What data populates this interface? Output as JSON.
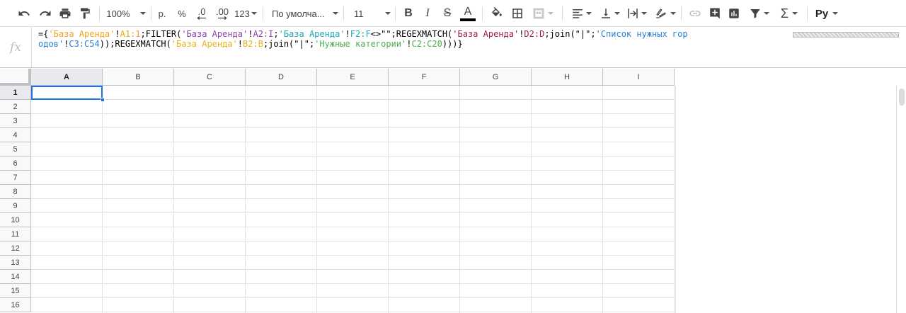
{
  "toolbar": {
    "zoom": "100%",
    "currency": "р.",
    "percent": "%",
    "dec_decrease": ".0",
    "dec_increase": ".00",
    "more_formats": "123",
    "font_family": "По умолча...",
    "font_size": "11",
    "bold": "B",
    "italic": "I",
    "strike": "S",
    "text_color_letter": "A",
    "text_color": "#000000",
    "spell_input": "Py",
    "icons": [
      "undo-icon",
      "redo-icon",
      "print-icon",
      "paint-format-icon",
      "fill-color-icon",
      "borders-icon",
      "merge-cells-icon",
      "align-left-icon",
      "valign-bottom-icon",
      "text-wrap-icon",
      "text-rotation-icon",
      "link-icon",
      "comment-icon",
      "chart-icon",
      "filter-icon",
      "sum-icon",
      "input-tools-icon"
    ]
  },
  "formula_bar": {
    "fx_label": "fx",
    "tokens": [
      {
        "text": "={",
        "color": "k"
      },
      {
        "text": "'База Аренда'",
        "color": "o"
      },
      {
        "text": "!",
        "color": "k"
      },
      {
        "text": "A1:1",
        "color": "o"
      },
      {
        "text": ";FILTER(",
        "color": "k"
      },
      {
        "text": "'База Аренда'",
        "color": "p"
      },
      {
        "text": "!",
        "color": "k"
      },
      {
        "text": "A2:I",
        "color": "p"
      },
      {
        "text": ";",
        "color": "k"
      },
      {
        "text": "'База Аренда'",
        "color": "t"
      },
      {
        "text": "!",
        "color": "k"
      },
      {
        "text": "F2:F",
        "color": "t"
      },
      {
        "text": "<>\"\";REGEXMATCH(",
        "color": "k"
      },
      {
        "text": "'База Аренда'",
        "color": "r"
      },
      {
        "text": "!",
        "color": "k"
      },
      {
        "text": "D2:D",
        "color": "r"
      },
      {
        "text": ";join(\"|\";",
        "color": "k"
      },
      {
        "text": "'Список нужных городов'",
        "color": "b"
      },
      {
        "text": "!",
        "color": "k"
      },
      {
        "text": "C3:C54",
        "color": "b"
      },
      {
        "text": "));REGEXMATCH(",
        "color": "k"
      },
      {
        "text": "'База Аренда'",
        "color": "y"
      },
      {
        "text": "!",
        "color": "k"
      },
      {
        "text": "B2:B",
        "color": "y"
      },
      {
        "text": ";join(\"|\";",
        "color": "k"
      },
      {
        "text": "'Нужные категории'",
        "color": "g"
      },
      {
        "text": "!",
        "color": "k"
      },
      {
        "text": "C2:C20",
        "color": "g"
      },
      {
        "text": ")))}",
        "color": "k"
      }
    ]
  },
  "grid": {
    "columns": [
      "A",
      "B",
      "C",
      "D",
      "E",
      "F",
      "G",
      "H",
      "I"
    ],
    "rows": [
      "1",
      "2",
      "3",
      "4",
      "5",
      "6",
      "7",
      "8",
      "9",
      "10",
      "11",
      "12",
      "13",
      "14",
      "15",
      "16"
    ],
    "active_cell": "A1",
    "selection_color": "#1a73e8"
  }
}
